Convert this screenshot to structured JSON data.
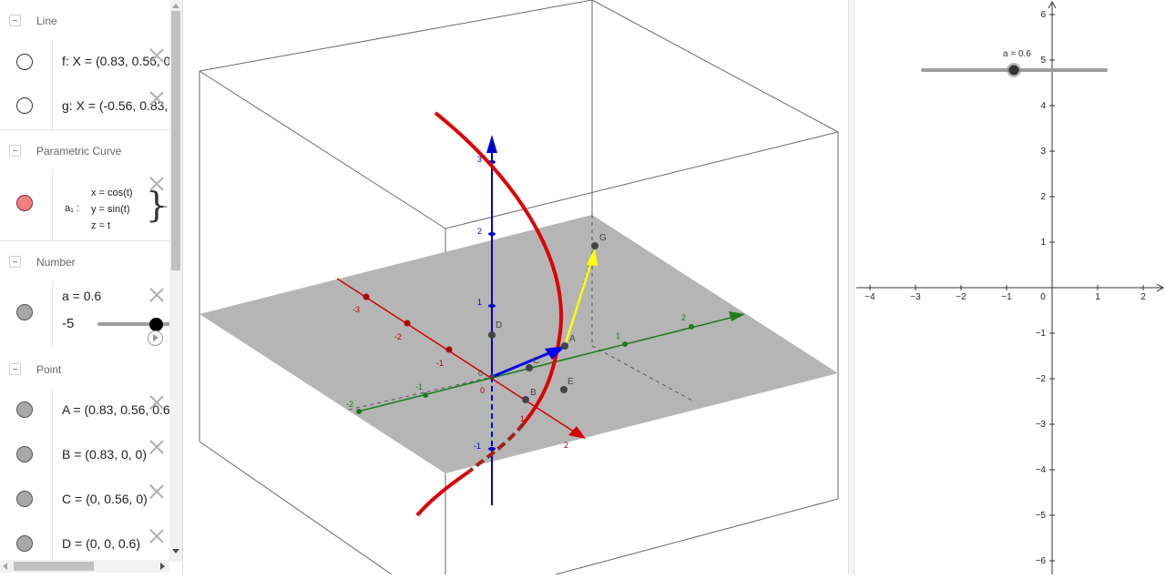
{
  "algebra": {
    "groups": {
      "line": "Line",
      "curve": "Parametric Curve",
      "number": "Number",
      "point": "Point"
    },
    "items": {
      "f": "f: X = (0.83, 0.56, 0",
      "g": "g: X = (-0.56, 0.83,",
      "curve_name": "a₁ :",
      "curve_x": "x = cos(t)",
      "curve_y": "y = sin(t)",
      "curve_z": "z = t",
      "curve_tail": "−",
      "number_a": "a = 0.6",
      "slider_min": "-5",
      "point_A": "A = (0.83, 0.56, 0.6",
      "point_B": "B = (0.83, 0, 0)",
      "point_C": "C = (0, 0.56, 0)",
      "point_D": "D = (0, 0, 0.6)"
    },
    "slider": {
      "a_value": 0.6,
      "min": -5,
      "max": 5
    }
  },
  "view3d": {
    "axis_x_ticks": [
      "-3",
      "-2",
      "-1",
      "0",
      "1",
      "2"
    ],
    "axis_y_ticks": [
      "-2",
      "-1",
      "1",
      "2",
      "3"
    ],
    "axis_z_ticks": [
      "-1",
      "1",
      "2",
      "3"
    ],
    "origin_label": "0",
    "point_labels": {
      "A": "A",
      "B": "B",
      "C": "C",
      "D": "D",
      "E": "E",
      "G": "G"
    },
    "colors": {
      "x_axis": "#d40000",
      "y_axis": "#1f7a1f",
      "z_axis": "#0000cc",
      "curve": "#dd0000",
      "vector_blue": "#0000ee",
      "vector_yellow": "#ffff00",
      "plane": "#b5b5b5"
    }
  },
  "view2d": {
    "x_ticks": [
      "−4",
      "−3",
      "−2",
      "−1",
      "0",
      "1",
      "2"
    ],
    "y_ticks": [
      "6",
      "5",
      "4",
      "3",
      "2",
      "1",
      "−1",
      "−2",
      "−3",
      "−4",
      "−5",
      "−6"
    ],
    "slider_label": "a = 0.6"
  }
}
